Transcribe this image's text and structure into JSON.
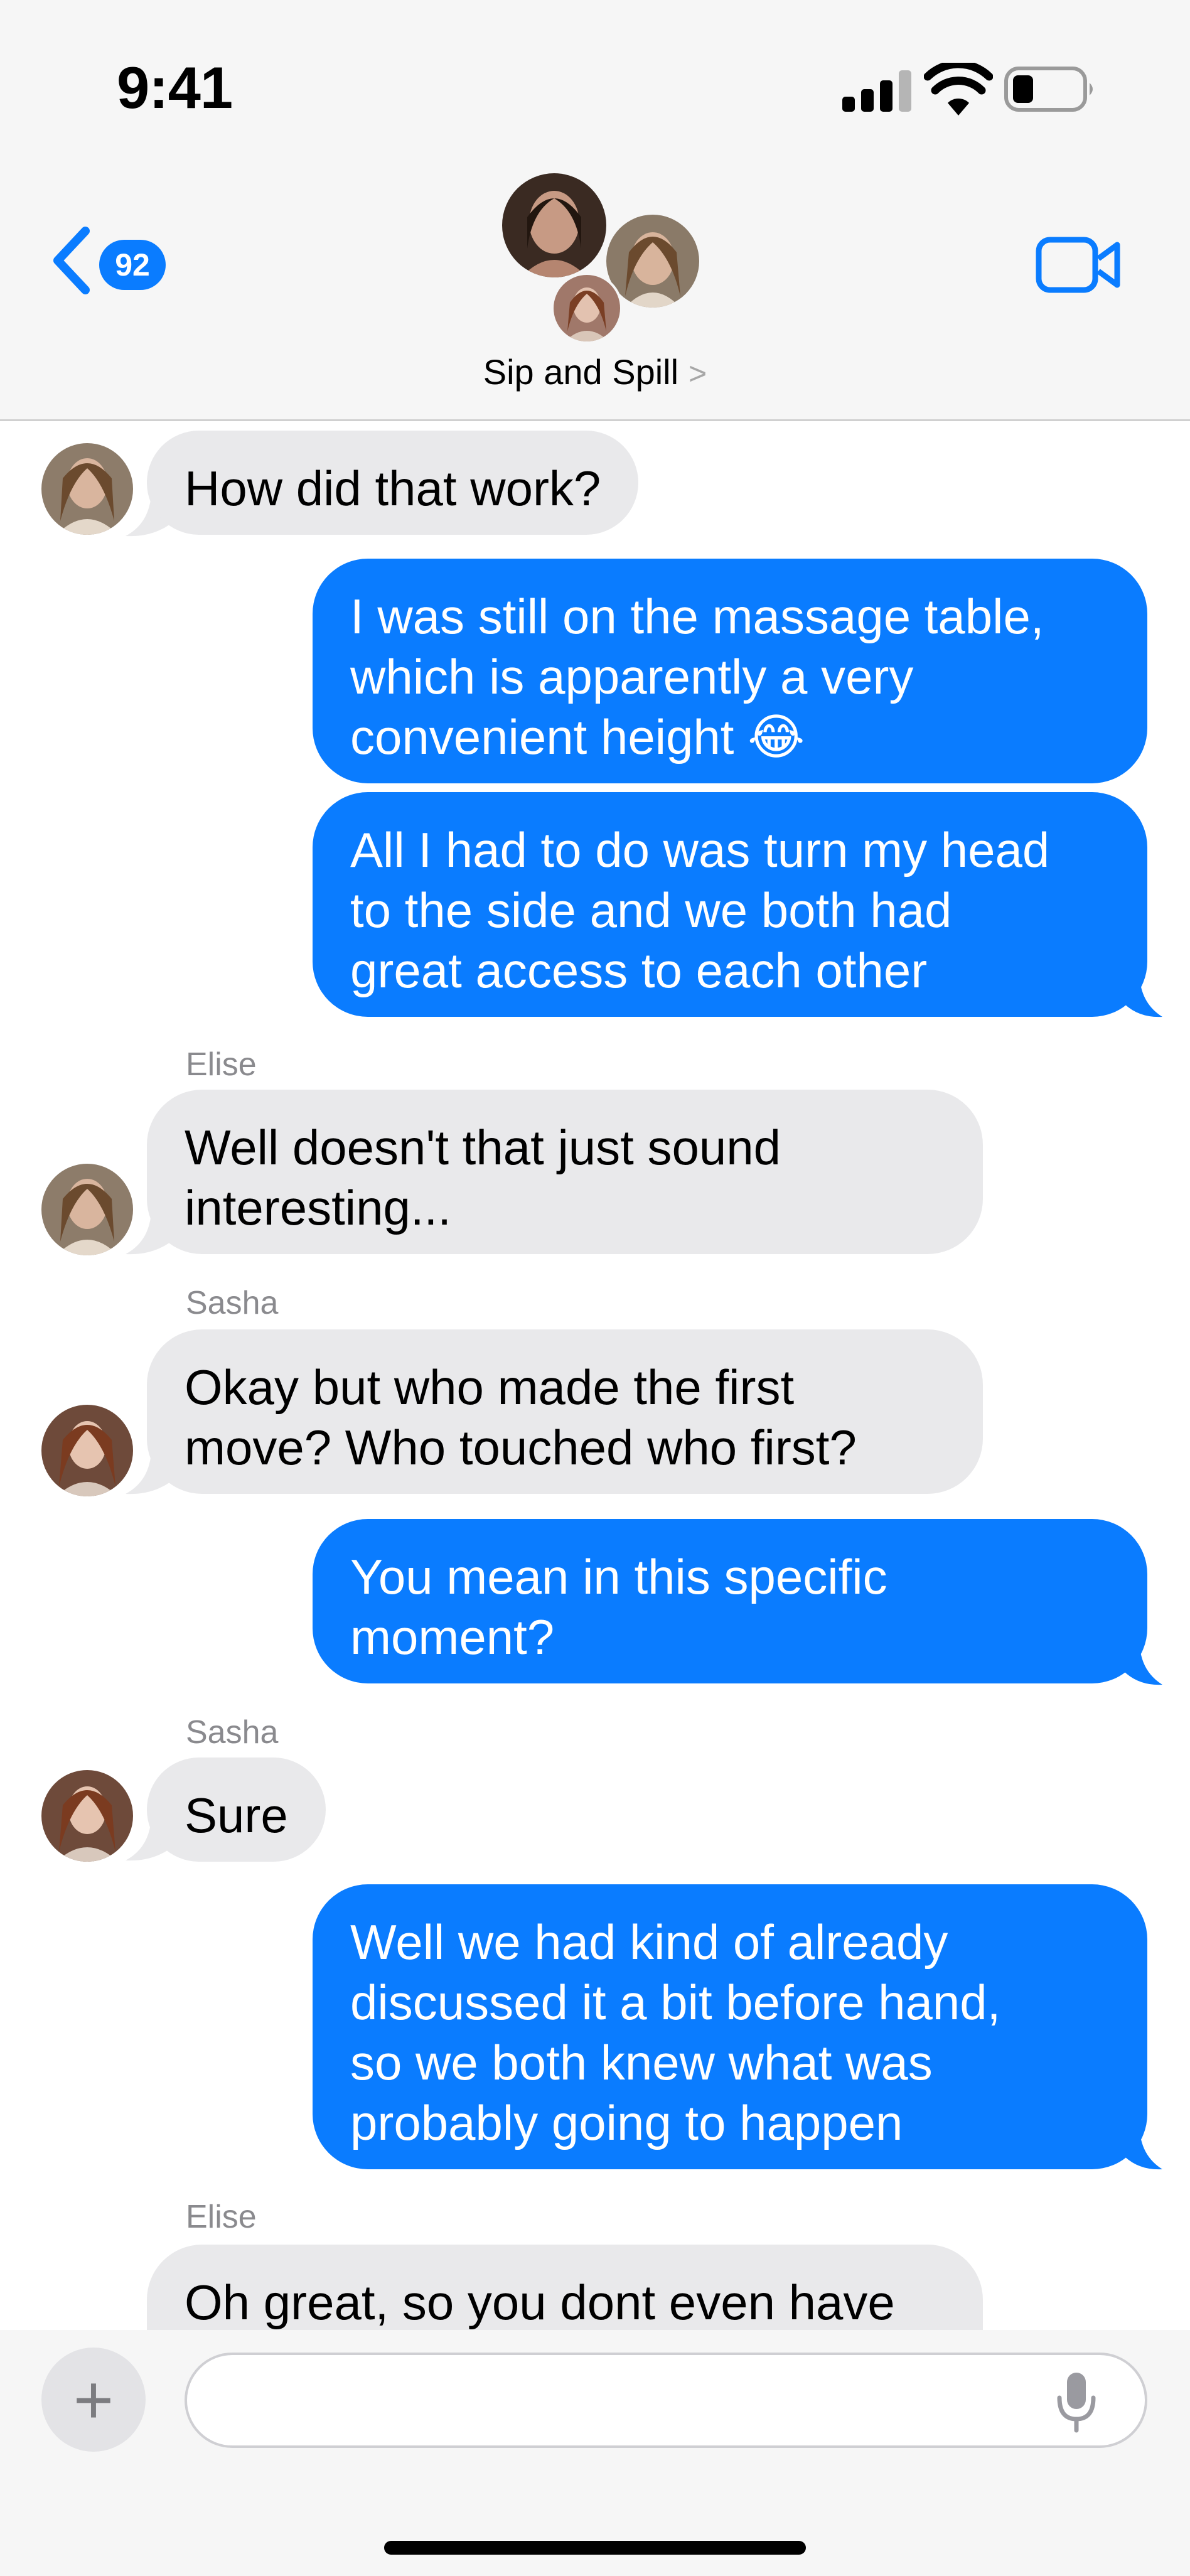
{
  "status_bar": {
    "time": "9:41"
  },
  "header": {
    "back_badge": "92",
    "group_name": "Sip and Spill",
    "chevron": ">"
  },
  "messages": [
    {
      "id": "m1",
      "direction": "incoming",
      "sender": "",
      "text": "How did that work?"
    },
    {
      "id": "m2",
      "direction": "outgoing",
      "lines": [
        "I was still on the massage table,",
        "which is apparently a very",
        "convenient height"
      ],
      "emoji": "😂"
    },
    {
      "id": "m3",
      "direction": "outgoing",
      "lines": [
        "All I had to do was turn my head",
        "to the side and we both had",
        "great access to each other"
      ]
    },
    {
      "id": "m4",
      "direction": "incoming",
      "sender": "Elise",
      "lines": [
        "Well doesn't that just sound",
        "interesting..."
      ]
    },
    {
      "id": "m5",
      "direction": "incoming",
      "sender": "Sasha",
      "lines": [
        "Okay but who made the first",
        "move? Who touched who first?"
      ]
    },
    {
      "id": "m6",
      "direction": "outgoing",
      "lines": [
        "You mean in this specific",
        "moment?"
      ]
    },
    {
      "id": "m7",
      "direction": "incoming",
      "sender": "Sasha",
      "text": "Sure"
    },
    {
      "id": "m8",
      "direction": "outgoing",
      "lines": [
        "Well we had kind of already",
        "discussed it a bit before hand,",
        "so we both knew what was",
        "probably going to happen"
      ]
    },
    {
      "id": "m9",
      "direction": "incoming",
      "sender": "Elise",
      "text": "Oh great, so you dont even have"
    }
  ],
  "composer": {
    "plus": "+",
    "placeholder": ""
  },
  "colors": {
    "outgoing": "#0a7cff",
    "incoming": "#e9e9eb",
    "header_bg": "#f6f6f6",
    "badge": "#0a7cff"
  },
  "icons": [
    "back-chevron-icon",
    "video-camera-icon",
    "signal-icon",
    "wifi-icon",
    "battery-icon",
    "plus-icon",
    "microphone-icon"
  ]
}
